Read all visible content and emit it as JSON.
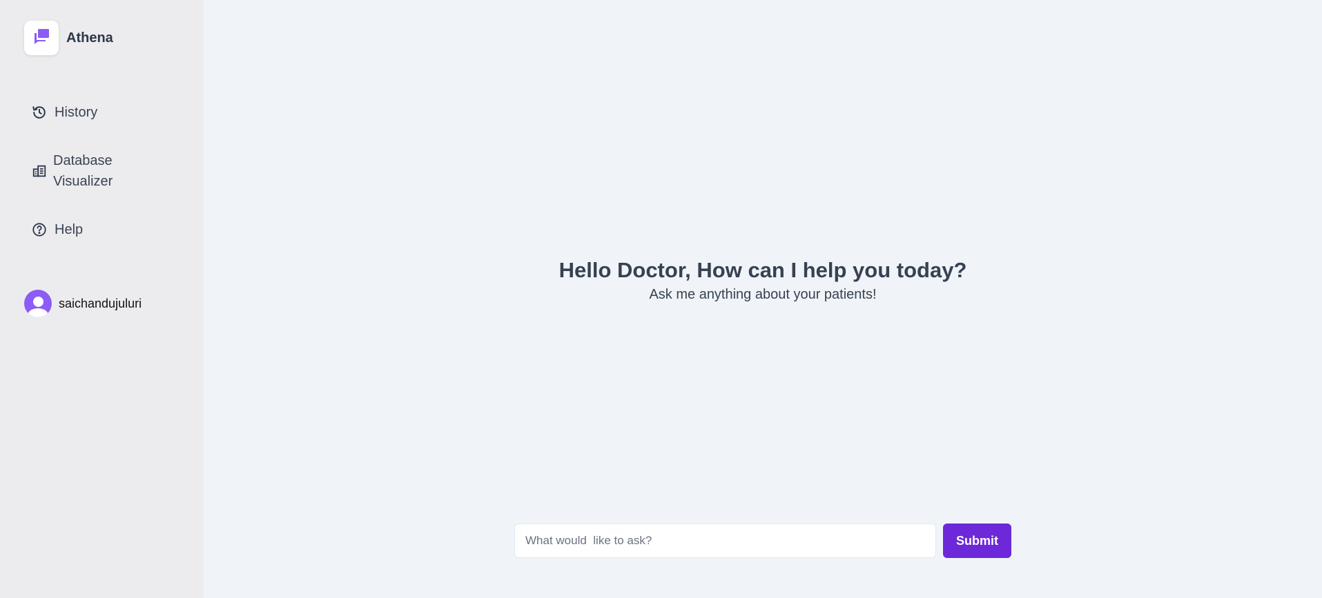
{
  "sidebar": {
    "brand": {
      "name": "Athena",
      "icon": "chat-bubbles-icon"
    },
    "nav": [
      {
        "label": "History",
        "icon": "history-icon"
      },
      {
        "label": "Database Visualizer",
        "icon": "database-chart-icon"
      },
      {
        "label": "Help",
        "icon": "help-circle-icon"
      }
    ],
    "user": {
      "name": "saichandujuluri",
      "icon": "user-avatar-icon"
    }
  },
  "main": {
    "heading": "Hello Doctor, How can I help you today?",
    "subheading": "Ask me anything about your patients!",
    "composer": {
      "placeholder": "What would  like to ask?",
      "value": "",
      "submit_label": "Submit"
    }
  },
  "colors": {
    "accent": "#6d28d9",
    "avatar": "#8b5cf6",
    "logo_icon": "#8b5cf6",
    "sidebar_bg": "#ececee",
    "main_bg": "#f0f4f8"
  }
}
